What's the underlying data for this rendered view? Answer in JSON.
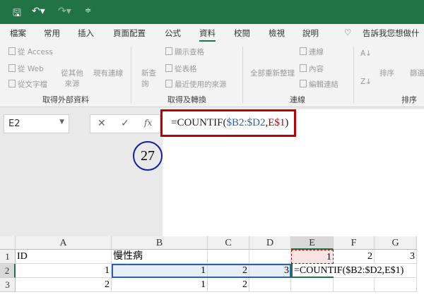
{
  "quick_access": {
    "save": "save-icon",
    "undo": "undo-icon",
    "redo": "redo-icon",
    "customize": "customize-icon"
  },
  "tabs": [
    "檔案",
    "常用",
    "插入",
    "頁面配置",
    "公式",
    "資料",
    "校閱",
    "檢視",
    "說明"
  ],
  "tell_me": "告訴我您想做什",
  "ribbon": {
    "groups": [
      {
        "label": "取得外部資料",
        "items": [
          "從 Access",
          "從 Web",
          "從文字檔",
          "從其他來源",
          "現有連線"
        ]
      },
      {
        "label": "取得及轉換",
        "items": [
          "新查詢",
          "顯示查格",
          "從表格",
          "最近使用的來源"
        ]
      },
      {
        "label": "連線",
        "items": [
          "全部重新整理",
          "連線",
          "內容",
          "編輯連結"
        ]
      },
      {
        "label": "排序與",
        "items": [
          "排序",
          "篩選"
        ]
      }
    ]
  },
  "name_box": "E2",
  "formula": {
    "prefix": "=COUNTIF(",
    "range": "$B2:$D2",
    ",": ",",
    "ref": "E$1",
    "suffix": ")"
  },
  "annotation": "27",
  "colors": {
    "title": "#217346",
    "range": "#2e5fa8",
    "ref": "#c00000"
  },
  "columns": [
    "A",
    "B",
    "C",
    "D",
    "E",
    "F",
    "G"
  ],
  "rows": [
    {
      "num": "1",
      "cells": [
        "ID",
        "慢性病",
        "",
        "",
        "1",
        "2",
        "3"
      ]
    },
    {
      "num": "2",
      "cells": [
        "1",
        "1",
        "2",
        "3",
        "=COUNTIF($B2:$D2,E$1)",
        "",
        ""
      ]
    },
    {
      "num": "3",
      "cells": [
        "2",
        "1",
        "2",
        "",
        "",
        "",
        ""
      ]
    }
  ]
}
